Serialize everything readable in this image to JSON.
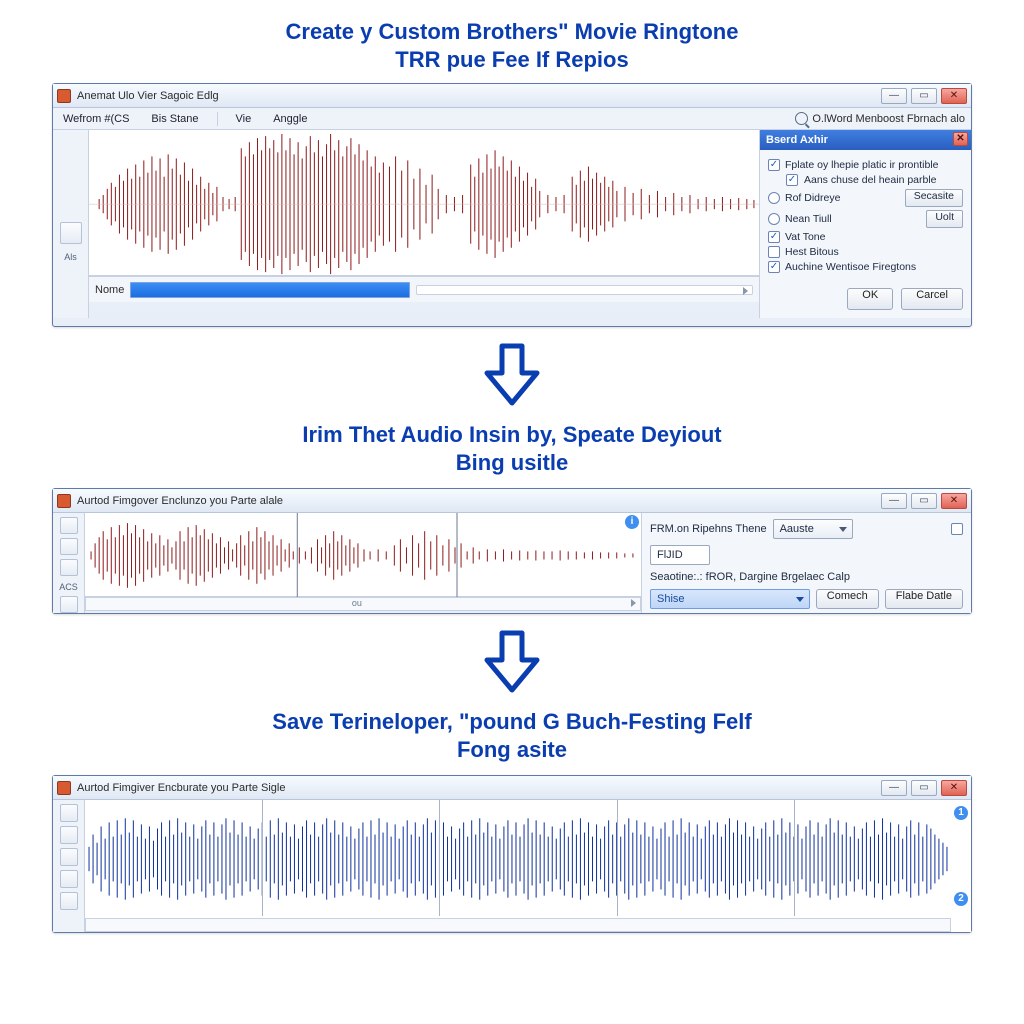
{
  "hero": {
    "line1": "Create y Custom Brothers\" Movie Ringtone",
    "line2": "TRR pue Fee If Repios"
  },
  "step2": {
    "line1": "Irim Thet Audio Insin by, Speate Deyiout",
    "line2": "Bing usitle"
  },
  "step3": {
    "line1": "Save Terineloper, \"pound G Buch-Festing Felf",
    "line2": "Fong asite"
  },
  "window1": {
    "title": "Anemat Ulo Vier Sagoic Edlg",
    "menu": {
      "item1": "Wefrom #(CS",
      "item2": "Bis Stane",
      "item3": "Vie",
      "item4": "Anggle",
      "search_label": "O.lWord Menboost Fbrnach alo"
    },
    "left_label": "Als",
    "status": {
      "label": "Nome"
    },
    "options": {
      "header": "Bserd Axhir",
      "chk1": "Fplate oy lhepie platic ir prontible",
      "chk2": "Aans chuse del heain parble",
      "rdo1": "Rof Didreye",
      "rdo2": "Nean Tiull",
      "chk3": "Vat Tone",
      "chk4": "Hest Bitous",
      "chk5": "Auchine Wentisoe Firegtons",
      "btn_secasite": "Secasite",
      "btn_uot": "Uolt",
      "ok": "OK",
      "cancel": "Carcel"
    }
  },
  "window2": {
    "title": "Aurtod Fimgover Enclunzo you Parte alale",
    "left_label": "ACS",
    "track_mark": "ou",
    "form": {
      "label1": "FRM.on Ripehns Thene",
      "dd1": "Aauste",
      "field2": "FlJID",
      "label3": "Seaotine:.: fROR, Dargine Brgelaec Calp",
      "bluefield": "Shise",
      "btn_comech": "Comech",
      "btn_fade": "Flabe Datle"
    }
  },
  "window3": {
    "title": "Aurtod Fimgiver Encburate you Parte Sigle",
    "info1": "1",
    "info2": "2"
  },
  "colors": {
    "wave_red": "#8e1d1d",
    "wave_blue": "#10329e",
    "accent_blue": "#0a3db0"
  }
}
